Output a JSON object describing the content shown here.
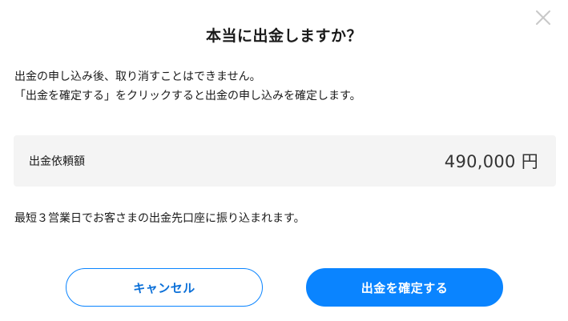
{
  "dialog": {
    "title": "本当に出金しますか？",
    "close_icon": "close-icon",
    "description_lines": [
      "出金の申し込み後、取り消すことはできません。",
      "「出金を確定する」をクリックすると出金の申し込みを確定します。"
    ],
    "amount": {
      "label": "出金依頼額",
      "value": "490,000 円"
    },
    "note": "最短３営業日でお客さまの出金先口座に振り込まれます。",
    "buttons": {
      "cancel_label": "キャンセル",
      "confirm_label": "出金を確定する"
    },
    "colors": {
      "accent": "#0a84ff",
      "panel": "#f4f4f4",
      "close_icon": "#c8c8c8"
    }
  }
}
